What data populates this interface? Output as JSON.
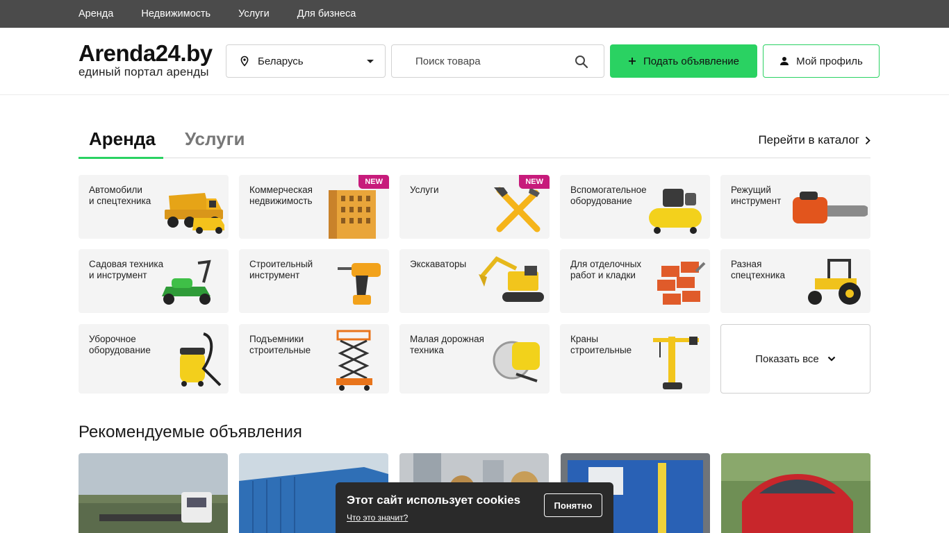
{
  "topnav": [
    "Аренда",
    "Недвижимость",
    "Услуги",
    "Для бизнеса"
  ],
  "logo": {
    "title": "Arenda24.by",
    "subtitle": "единый портал аренды"
  },
  "region": {
    "value": "Беларусь",
    "icon": "map-pin-icon"
  },
  "search": {
    "placeholder": "Поиск товара",
    "icon": "search-icon"
  },
  "buttons": {
    "post": "Подать объявление",
    "profile": "Мой профиль"
  },
  "tabs": {
    "active": "Аренда",
    "inactive": "Услуги",
    "catalog_link": "Перейти в каталог"
  },
  "categories": [
    {
      "label": "Автомобили\nи спецтехника",
      "icon": "dump-truck-icon"
    },
    {
      "label": "Коммерческая\nнедвижимость",
      "icon": "building-icon",
      "badge": "NEW"
    },
    {
      "label": "Услуги",
      "icon": "tools-icon",
      "badge": "NEW"
    },
    {
      "label": "Вспомогательное\nоборудование",
      "icon": "compressor-icon"
    },
    {
      "label": "Режущий\nинструмент",
      "icon": "chainsaw-icon"
    },
    {
      "label": "Садовая техника\nи инструмент",
      "icon": "lawn-mower-icon"
    },
    {
      "label": "Строительный\nинструмент",
      "icon": "drill-icon"
    },
    {
      "label": "Экскаваторы",
      "icon": "excavator-icon"
    },
    {
      "label": "Для отделочных\nработ и кладки",
      "icon": "bricks-icon"
    },
    {
      "label": "Разная\nспецтехника",
      "icon": "tractor-icon"
    },
    {
      "label": "Уборочное\nоборудование",
      "icon": "vacuum-cleaner-icon"
    },
    {
      "label": "Подъемники\nстроительные",
      "icon": "scissor-lift-icon"
    },
    {
      "label": "Малая дорожная\nтехника",
      "icon": "concrete-saw-icon"
    },
    {
      "label": "Краны\nстроительные",
      "icon": "tower-crane-icon"
    }
  ],
  "show_all": "Показать все",
  "recommended_title": "Рекомендуемые объявления",
  "listings": [
    {
      "icon": "truck-photo"
    },
    {
      "icon": "container-photo"
    },
    {
      "icon": "street-photo"
    },
    {
      "icon": "container-photo"
    },
    {
      "icon": "car-photo"
    }
  ],
  "cookie": {
    "title": "Этот сайт использует cookies",
    "link": "Что это значит?",
    "button": "Понятно"
  },
  "colors": {
    "accent": "#2ad262",
    "topbar": "#4b4b4b",
    "badge": "#c71b7b",
    "card": "#f4f4f4"
  }
}
